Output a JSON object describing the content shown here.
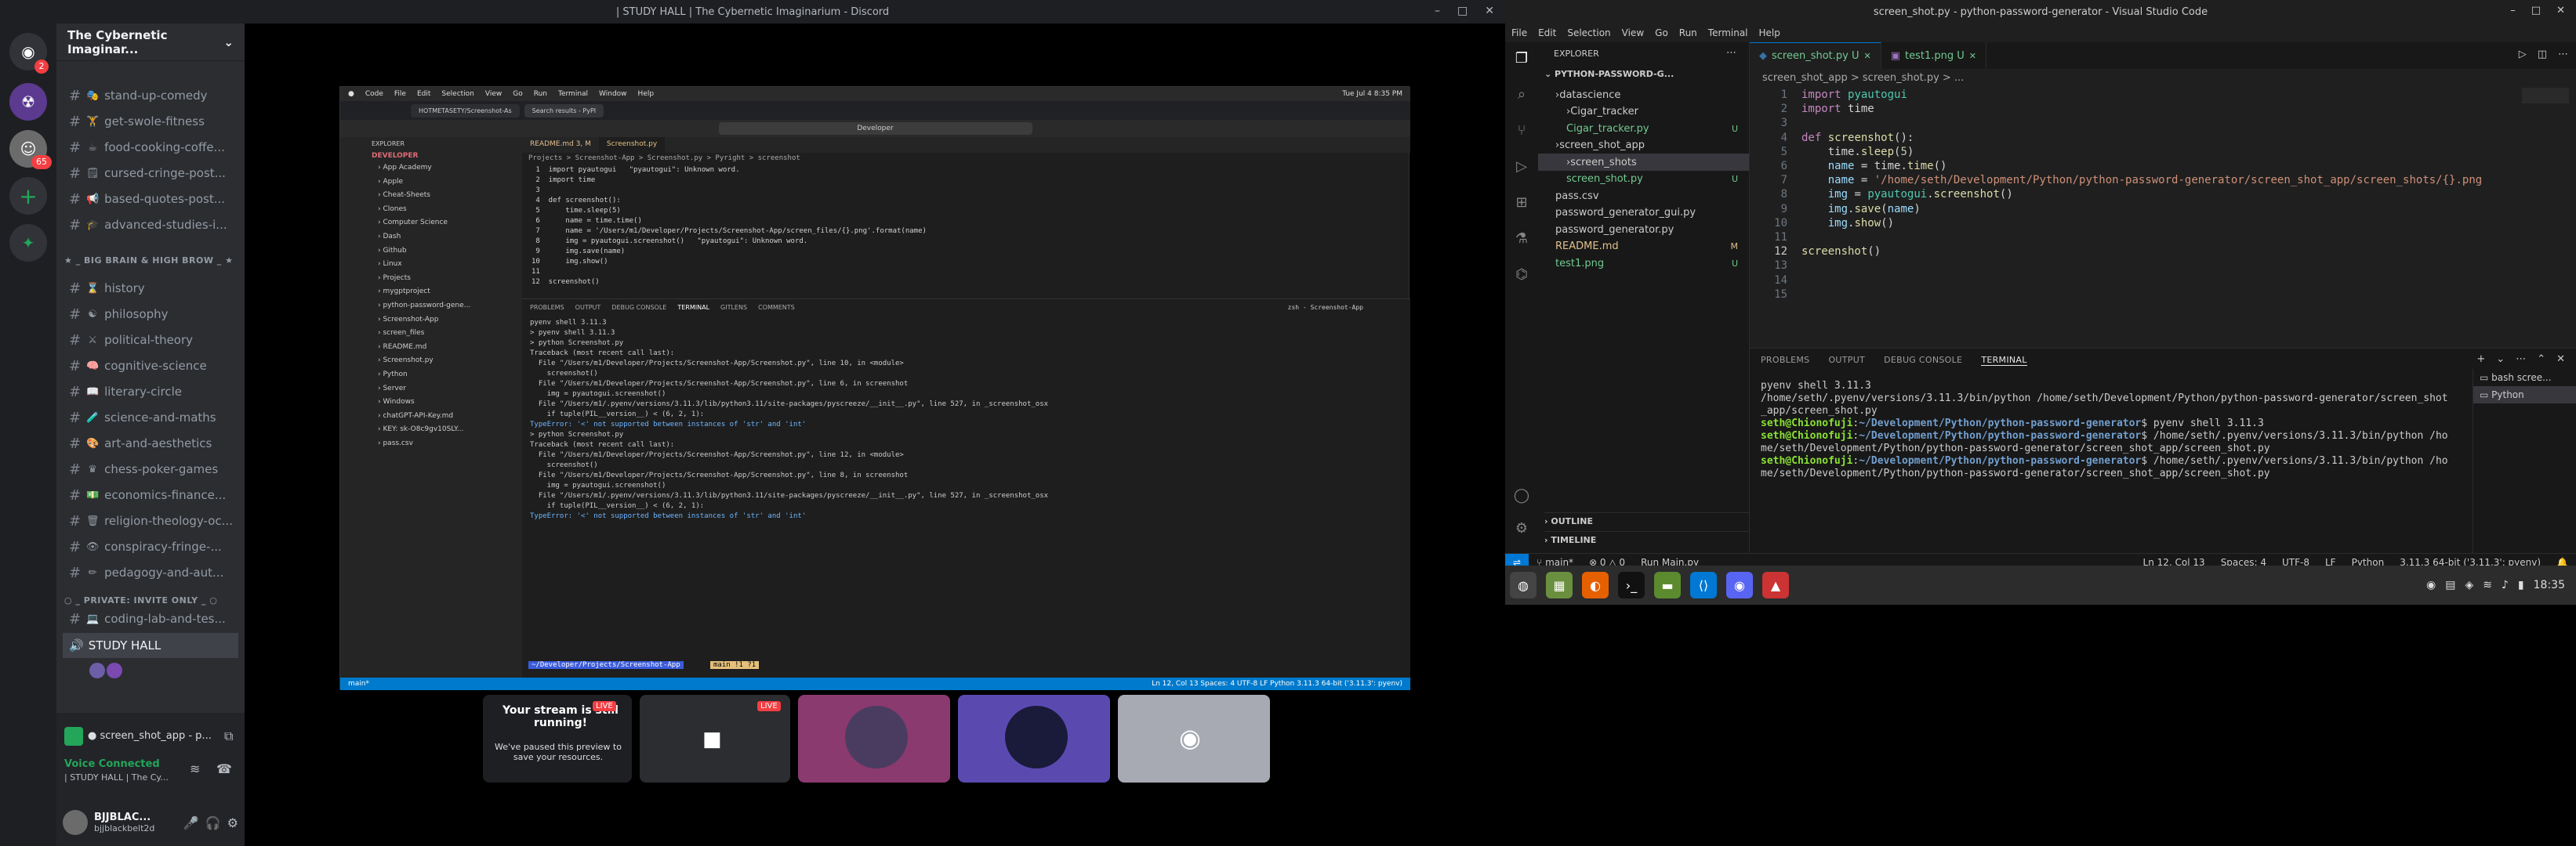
{
  "discord": {
    "window_title": "| STUDY HALL | The Cybernetic Imaginarium - Discord",
    "server_name": "The Cybernetic Imaginar...",
    "mention_count": "2",
    "avatar_badge": "65",
    "channels_top": [
      {
        "emoji": "🎭",
        "label": "stand-up-comedy"
      },
      {
        "emoji": "🏋",
        "label": "get-swole-fitness"
      },
      {
        "emoji": "☕",
        "label": "food-cooking-coffe..."
      },
      {
        "emoji": "🗒",
        "label": "cursed-cringe-post..."
      },
      {
        "emoji": "📢",
        "label": "based-quotes-post..."
      },
      {
        "emoji": "🎓",
        "label": "advanced-studies-i..."
      }
    ],
    "category_1": "★ _ BIG BRAIN & HIGH BROW _ ★",
    "channels_mid": [
      {
        "emoji": "⌛",
        "label": "history"
      },
      {
        "emoji": "☯",
        "label": "philosophy"
      },
      {
        "emoji": "⚔",
        "label": "political-theory"
      },
      {
        "emoji": "🧠",
        "label": "cognitive-science"
      },
      {
        "emoji": "📖",
        "label": "literary-circle"
      },
      {
        "emoji": "🧪",
        "label": "science-and-maths"
      },
      {
        "emoji": "🎨",
        "label": "art-and-aesthetics"
      },
      {
        "emoji": "♛",
        "label": "chess-poker-games"
      },
      {
        "emoji": "💵",
        "label": "economics-finance..."
      },
      {
        "emoji": "🗑",
        "label": "religion-theology-oc..."
      },
      {
        "emoji": "👁",
        "label": "conspiracy-fringe-..."
      },
      {
        "emoji": "✏",
        "label": "pedagogy-and-aut..."
      }
    ],
    "category_2": "○ _ PRIVATE: INVITE ONLY _ ○",
    "channels_private": [
      {
        "emoji": "💻",
        "label": "coding-lab-and-tes..."
      }
    ],
    "voice_channel": "STUDY HALL",
    "stream_title": "● screen_shot_app - p...",
    "voice_status": "Voice Connected",
    "voice_sub": "| STUDY HALL | The Cy...",
    "username": "BJJBLAC...",
    "user_tag": "bjjblackbelt2d",
    "stream_notice_title": "Your stream is still running!",
    "stream_notice_body": "We've paused this preview to save your resources.",
    "live_label": "LIVE"
  },
  "shared_screen": {
    "mac_menu": [
      "Code",
      "File",
      "Edit",
      "Selection",
      "View",
      "Go",
      "Run",
      "Terminal",
      "Window",
      "Help"
    ],
    "mac_clock": "Tue Jul 4  8:35 PM",
    "browser_tab_1": "HOTMETASETY/Screenshot-As",
    "browser_tab_2": "Search results - PyPI",
    "search_box": "Developer",
    "explorer_title": "EXPLORER",
    "root": "DEVELOPER",
    "tree": [
      "App Academy",
      "Apple",
      "Cheat-Sheets",
      "Clones",
      "Computer Science",
      "Dash",
      "Github",
      "Linux",
      "Projects",
      "mygptproject",
      "python-password-gene...",
      "Screenshot-App",
      "screen_files",
      "README.md",
      "Screenshot.py",
      "Python",
      "Server",
      "Windows",
      "chatGPT-API-Key.md",
      "KEY: sk-O8c9gv10SLY...",
      "pass.csv"
    ],
    "tabs": [
      "README.md 3, M",
      "Screenshot.py"
    ],
    "breadcrumb": "Projects > Screenshot-App > Screenshot.py > Pyright > screenshot",
    "code_lines": [
      "import pyautogui   \"pyautogui\": Unknown word.",
      "import time",
      "",
      "def screenshot():",
      "    time.sleep(5)",
      "    name = time.time()",
      "    name = '/Users/m1/Developer/Projects/Screenshot-App/screen_files/{}.png'.format(name)",
      "    img = pyautogui.screenshot()   \"pyautogui\": Unknown word.",
      "    img.save(name)",
      "    img.show()",
      "",
      "screenshot()"
    ],
    "panel_tabs": [
      "PROBLEMS",
      "OUTPUT",
      "DEBUG CONSOLE",
      "TERMINAL",
      "GITLENS",
      "COMMENTS"
    ],
    "panel_term_label": "zsh - Screenshot-App",
    "term_lines": [
      "pyenv shell 3.11.3",
      "> pyenv shell 3.11.3",
      "> python Screenshot.py",
      "Traceback (most recent call last):",
      "  File \"/Users/m1/Developer/Projects/Screenshot-App/Screenshot.py\", line 10, in <module>",
      "    screenshot()",
      "  File \"/Users/m1/Developer/Projects/Screenshot-App/Screenshot.py\", line 6, in screenshot",
      "    img = pyautogui.screenshot()",
      "",
      "  File \"/Users/m1/.pyenv/versions/3.11.3/lib/python3.11/site-packages/pyscreeze/__init__.py\", line 527, in _screenshot_osx",
      "    if tuple(PIL__version__) < (6, 2, 1):",
      "",
      "TypeError: '<' not supported between instances of 'str' and 'int'",
      "> python Screenshot.py",
      "Traceback (most recent call last):",
      "  File \"/Users/m1/Developer/Projects/Screenshot-App/Screenshot.py\", line 12, in <module>",
      "    screenshot()",
      "  File \"/Users/m1/Developer/Projects/Screenshot-App/Screenshot.py\", line 8, in screenshot",
      "    img = pyautogui.screenshot()",
      "",
      "  File \"/Users/m1/.pyenv/versions/3.11.3/lib/python3.11/site-packages/pyscreeze/__init__.py\", line 527, in _screenshot_osx",
      "    if tuple(PIL__version__) < (6, 2, 1):",
      "",
      "TypeError: '<' not supported between instances of 'str' and 'int'"
    ],
    "prompt": "~/Developer/Projects/Screenshot-App",
    "prompt_branch": "main !1 ?1",
    "status_left": "main*",
    "status_right": "Ln 12, Col 13   Spaces: 4   UTF-8   LF   Python   3.11.3 64-bit ('3.11.3': pyenv)"
  },
  "vscode": {
    "window_title": "screen_shot.py - python-password-generator - Visual Studio Code",
    "menu": [
      "File",
      "Edit",
      "Selection",
      "View",
      "Go",
      "Run",
      "Terminal",
      "Help"
    ],
    "explorer_title": "EXPLORER",
    "project": "PYTHON-PASSWORD-G...",
    "tree": [
      {
        "label": "datascience",
        "indent": 1,
        "type": "folder",
        "badge": "",
        "color": "#cccccc"
      },
      {
        "label": "Cigar_tracker",
        "indent": 2,
        "type": "folder",
        "badge": "",
        "color": "#cccccc"
      },
      {
        "label": "Cigar_tracker.py",
        "indent": 2,
        "type": "file",
        "badge": "U",
        "color": "#73c991"
      },
      {
        "label": "screen_shot_app",
        "indent": 1,
        "type": "folder",
        "badge": "",
        "color": "#cccccc"
      },
      {
        "label": "screen_shots",
        "indent": 2,
        "type": "folder",
        "badge": "",
        "color": "#cccccc"
      },
      {
        "label": "screen_shot.py",
        "indent": 2,
        "type": "file",
        "badge": "U",
        "color": "#73c991"
      },
      {
        "label": "pass.csv",
        "indent": 1,
        "type": "file",
        "badge": "",
        "color": "#cccccc"
      },
      {
        "label": "password_generator_gui.py",
        "indent": 1,
        "type": "file",
        "badge": "",
        "color": "#cccccc"
      },
      {
        "label": "password_generator.py",
        "indent": 1,
        "type": "file",
        "badge": "",
        "color": "#cccccc"
      },
      {
        "label": "README.md",
        "indent": 1,
        "type": "file",
        "badge": "M",
        "color": "#e2c08d"
      },
      {
        "label": "test1.png",
        "indent": 1,
        "type": "file",
        "badge": "U",
        "color": "#73c991"
      }
    ],
    "outline": "OUTLINE",
    "timeline": "TIMELINE",
    "tabs": [
      {
        "label": "screen_shot.py",
        "flag": "U"
      },
      {
        "label": "test1.png",
        "flag": "U"
      }
    ],
    "breadcrumb": "screen_shot_app > screen_shot.py > ...",
    "code": [
      "import pyautogui",
      "import time",
      "",
      "def screenshot():",
      "    time.sleep(5)",
      "    name = time.time()",
      "    name = '/home/seth/Development/Python/python-password-generator/screen_shot_app/screen_shots/{}.png",
      "    img = pyautogui.screenshot()",
      "    img.save(name)",
      "    img.show()",
      "",
      "screenshot()",
      "",
      "",
      ""
    ],
    "panel_tabs": [
      "PROBLEMS",
      "OUTPUT",
      "DEBUG CONSOLE",
      "TERMINAL"
    ],
    "terminal_list": [
      "bash  scree...",
      "Python"
    ],
    "terminal": [
      "pyenv shell 3.11.3",
      "/home/seth/.pyenv/versions/3.11.3/bin/python /home/seth/Development/Python/python-password-generator/screen_shot",
      "_app/screen_shot.py",
      "seth@Chionofuji:~/Development/Python/python-password-generator$ pyenv shell 3.11.3",
      "seth@Chionofuji:~/Development/Python/python-password-generator$ /home/seth/.pyenv/versions/3.11.3/bin/python /ho",
      "me/seth/Development/Python/python-password-generator/screen_shot_app/screen_shot.py",
      "seth@Chionofuji:~/Development/Python/python-password-generator$ /home/seth/.pyenv/versions/3.11.3/bin/python /ho",
      "me/seth/Development/Python/python-password-generator/screen_shot_app/screen_shot.py"
    ],
    "status": {
      "branch": "main*",
      "errors": "⊗ 0 △ 0",
      "run": "Run Main.py",
      "position": "Ln 12, Col 13",
      "spaces": "Spaces: 4",
      "encoding": "UTF-8",
      "eol": "LF",
      "language": "Python",
      "interpreter": "3.11.3 64-bit ('3.11.3': pyenv)"
    }
  },
  "taskbar": {
    "clock": "18:35"
  }
}
